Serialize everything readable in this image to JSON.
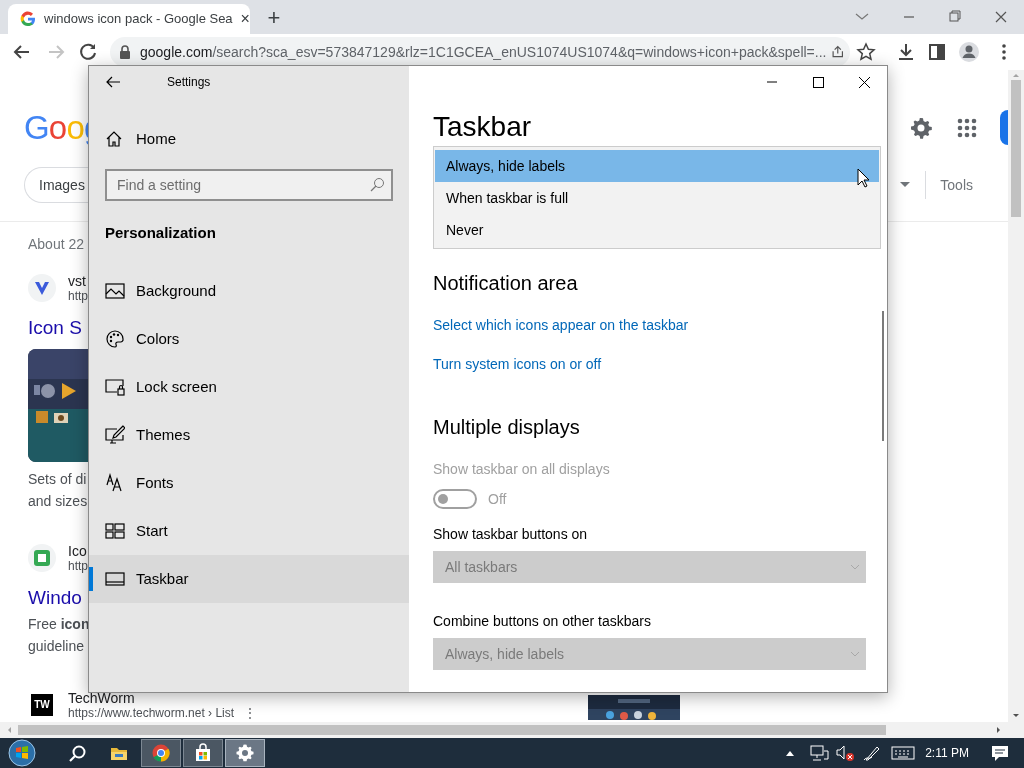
{
  "browser": {
    "tab": {
      "title": "windows icon pack - Google Sea",
      "close": "×"
    },
    "new_tab": "+",
    "forward_disabled": true,
    "address": {
      "host": "google.com",
      "path": "/search?sca_esv=573847129&rlz=1C1GCEA_enUS1074US1074&q=windows+icon+pack&spell=..."
    }
  },
  "google": {
    "logo": "Goog",
    "chip": "Images",
    "tools": "Tools",
    "result_count": "About 22",
    "results": [
      {
        "kind": "gallery",
        "site": "vst",
        "url": "http",
        "title": "Icon S",
        "snippet": [
          "Sets of di",
          "and sizes"
        ]
      },
      {
        "kind": "plain",
        "site": "Ico",
        "url": "http",
        "title": "Windo",
        "snippet": [
          "Free **icon**",
          "guideline"
        ]
      },
      {
        "kind": "media",
        "favicon_text": "TW",
        "site": "TechWorm",
        "url": "https://www.techworm.net › List",
        "menu": "⋮"
      }
    ]
  },
  "settings": {
    "title": "Settings",
    "home": "Home",
    "search_placeholder": "Find a setting",
    "section": "Personalization",
    "nav": [
      {
        "label": "Background",
        "kind": "background",
        "selected": false
      },
      {
        "label": "Colors",
        "kind": "colors",
        "selected": false
      },
      {
        "label": "Lock screen",
        "kind": "lock",
        "selected": false
      },
      {
        "label": "Themes",
        "kind": "themes",
        "selected": false
      },
      {
        "label": "Fonts",
        "kind": "fonts",
        "selected": false
      },
      {
        "label": "Start",
        "kind": "start",
        "selected": false
      },
      {
        "label": "Taskbar",
        "kind": "taskbar",
        "selected": true
      }
    ],
    "page_title": "Taskbar",
    "dropdown_menu": [
      {
        "label": "Always, hide labels",
        "selected": true
      },
      {
        "label": "When taskbar is full",
        "selected": false
      },
      {
        "label": "Never",
        "selected": false
      }
    ],
    "content": [
      {
        "kind": "heading",
        "text": "Notification area"
      },
      {
        "kind": "link",
        "text": "Select which icons appear on the taskbar"
      },
      {
        "kind": "link",
        "text": "Turn system icons on or off"
      },
      {
        "kind": "heading",
        "text": "Multiple displays"
      },
      {
        "kind": "toggle",
        "label": "Show taskbar on all displays",
        "on": false,
        "disabled": true,
        "state_text": "Off"
      },
      {
        "kind": "select",
        "label": "Show taskbar buttons on",
        "value": "All taskbars",
        "disabled": true
      },
      {
        "kind": "select",
        "label": "Combine buttons on other taskbars",
        "value": "Always, hide labels",
        "disabled": true
      }
    ]
  },
  "taskbar": {
    "apps": [
      {
        "kind": "search",
        "open": false,
        "active": false
      },
      {
        "kind": "explorer",
        "open": false,
        "active": false
      },
      {
        "kind": "chrome",
        "open": true,
        "active": false
      },
      {
        "kind": "store",
        "open": true,
        "active": false
      },
      {
        "kind": "settings",
        "open": true,
        "active": true
      }
    ],
    "clock": "2:11 PM"
  }
}
